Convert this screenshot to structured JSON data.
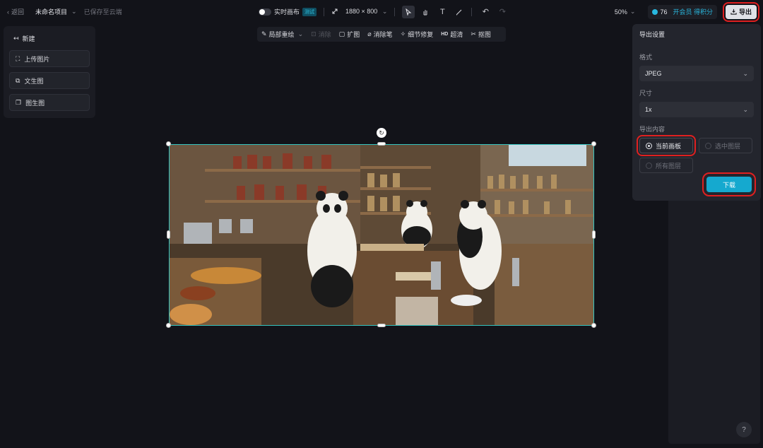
{
  "header": {
    "back_label": "返回",
    "project_name": "未命名项目",
    "save_status": "已保存至云端",
    "realtime_label": "实时画布",
    "beta_badge": "测试",
    "canvas_size": "1880 × 800",
    "zoom": "50%",
    "credits": "76",
    "vip_label": "开会员 得积分",
    "export_label": "导出"
  },
  "left_panel": {
    "new_label": "新建",
    "buttons": [
      "上传图片",
      "文生图",
      "图生图"
    ]
  },
  "edit_toolbar": {
    "items": [
      "局部重绘",
      "消除",
      "扩图",
      "消除笔",
      "细节修复",
      "超清",
      "抠图"
    ]
  },
  "export_panel": {
    "title": "导出设置",
    "format_label": "格式",
    "format_value": "JPEG",
    "size_label": "尺寸",
    "size_value": "1x",
    "content_label": "导出内容",
    "options": [
      "当前画板",
      "选中图层",
      "所有图层"
    ],
    "selected_option": "当前画板",
    "download_label": "下载"
  },
  "help_label": "?",
  "colors": {
    "accent": "#15a9cf",
    "highlight_box": "#e02020",
    "selection": "#35c4c0"
  }
}
